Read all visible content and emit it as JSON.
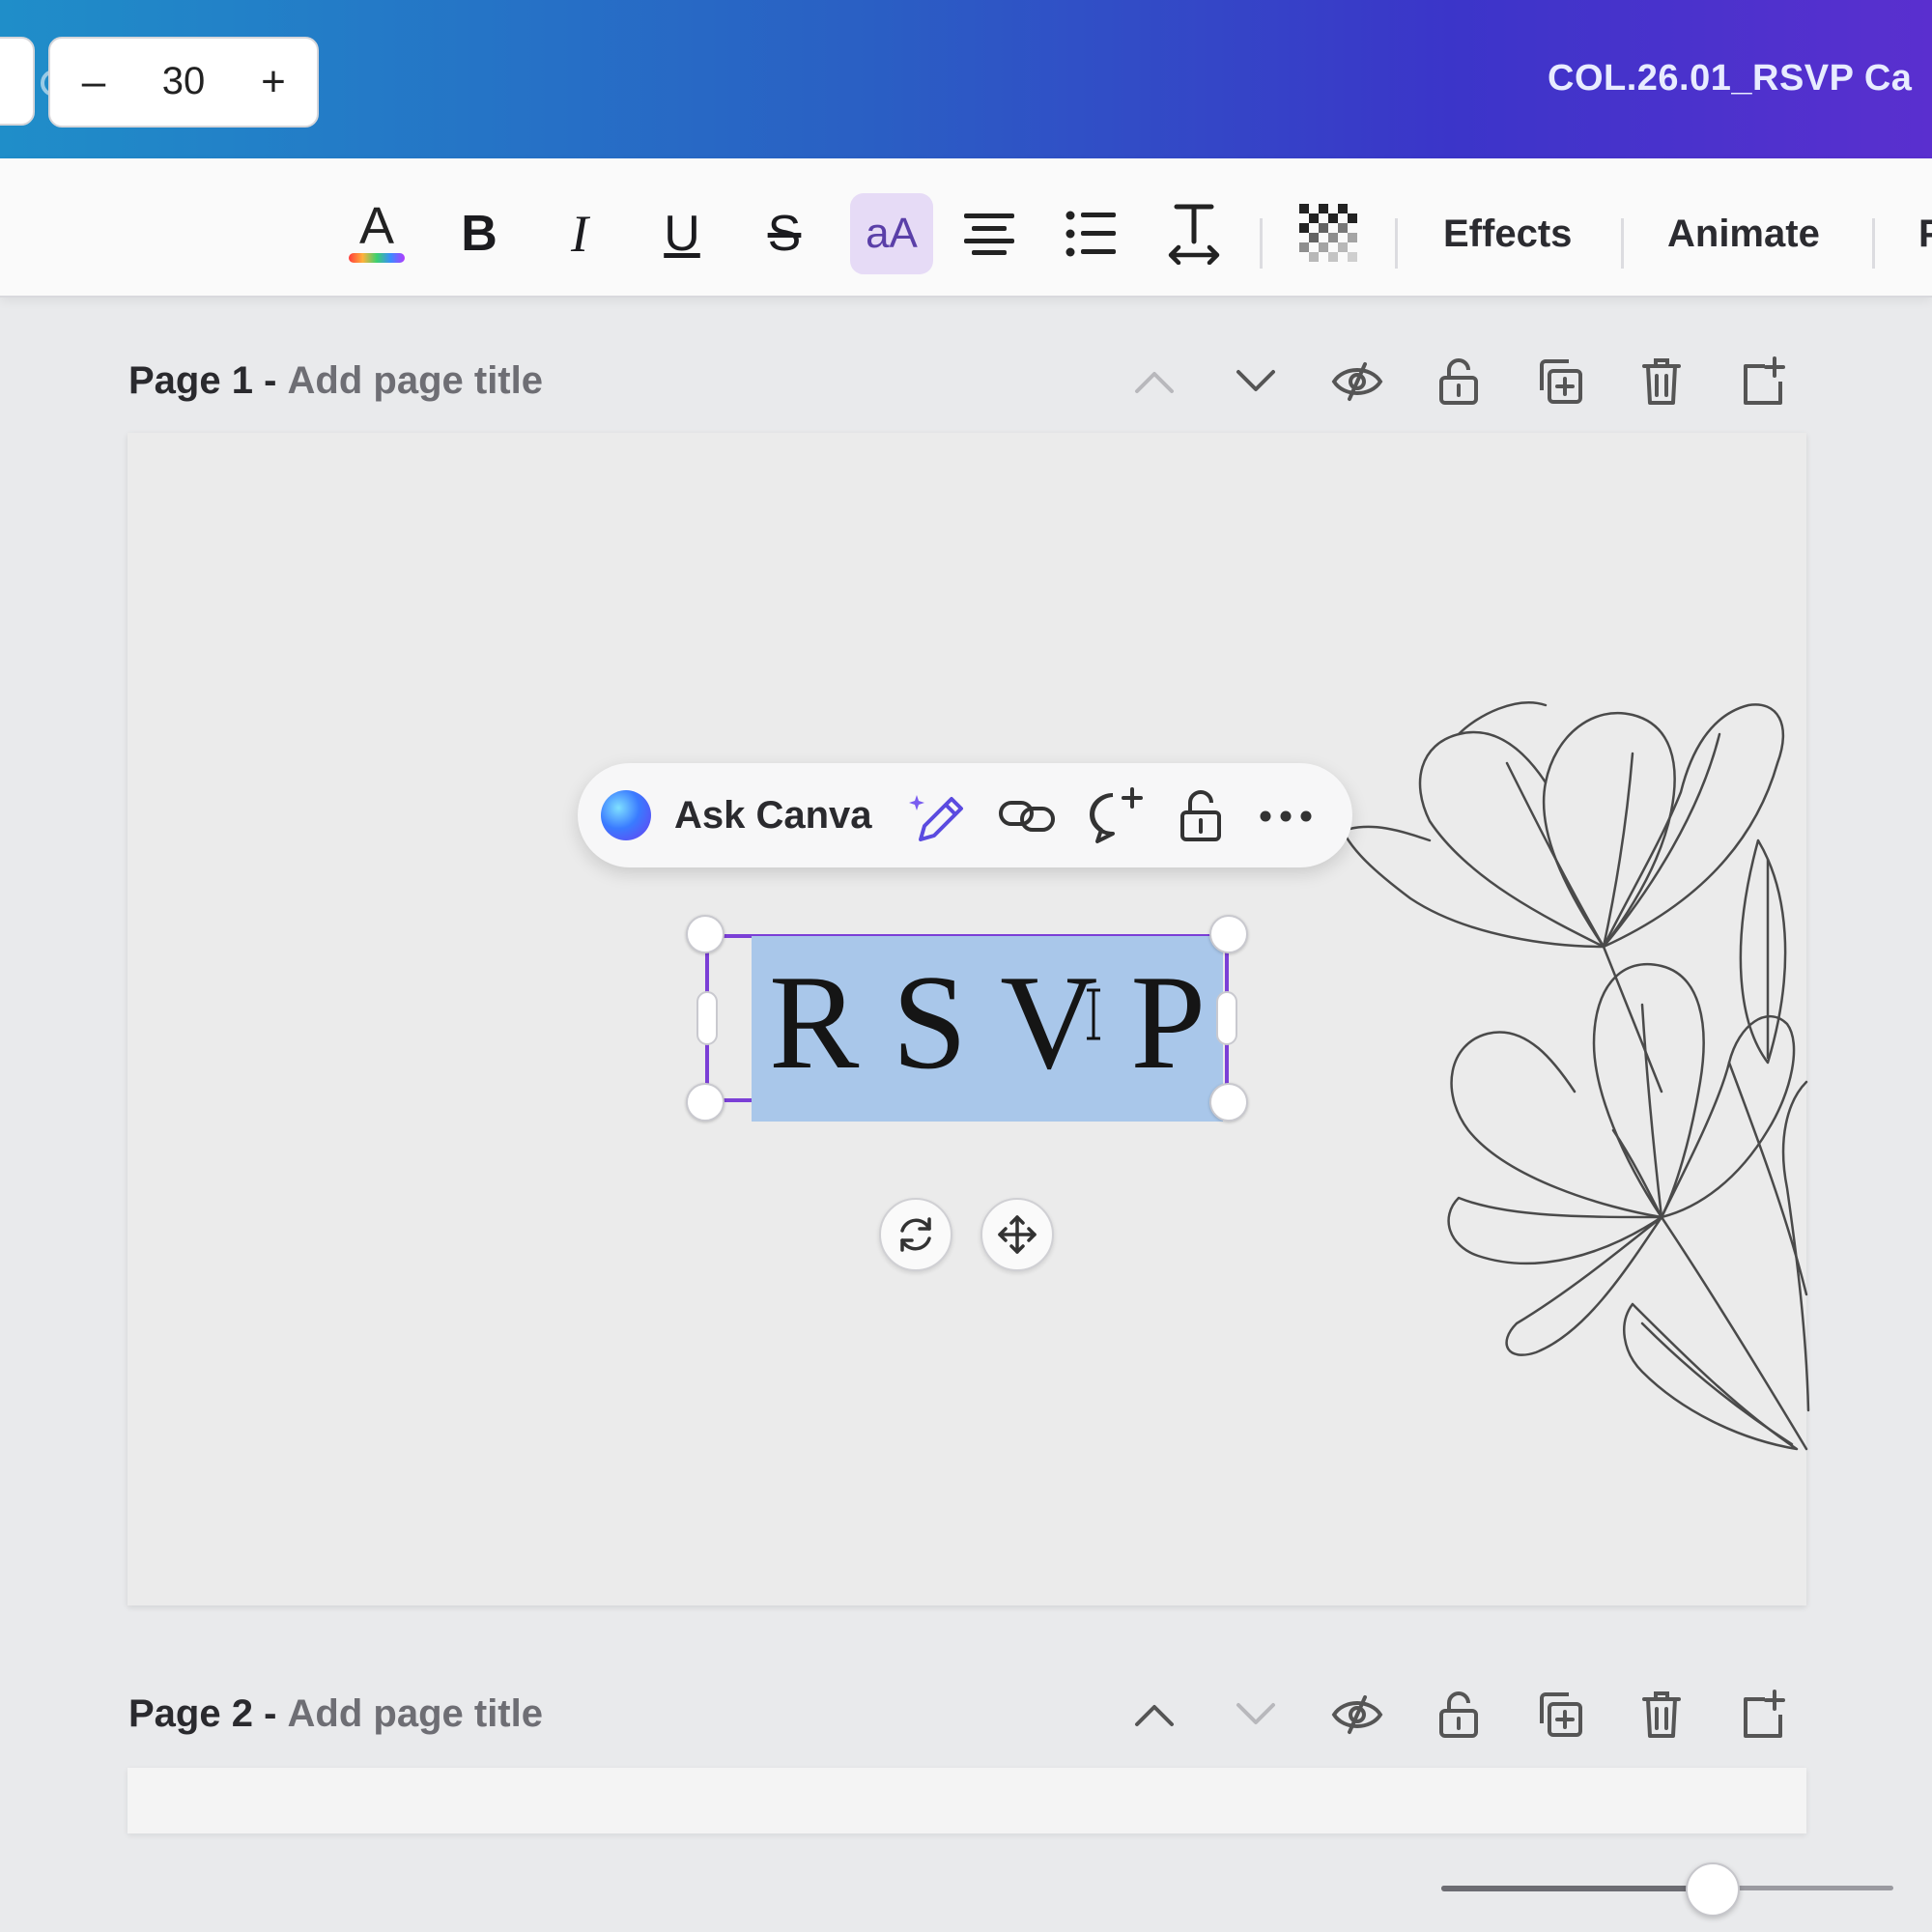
{
  "header": {
    "document_title": "COL.26.01_RSVP Ca"
  },
  "toolbar": {
    "font_size": "30",
    "minus_label": "–",
    "plus_label": "+",
    "bold_label": "B",
    "italic_label": "I",
    "underline_label": "U",
    "strike_label": "S",
    "case_label": "aA",
    "effects_label": "Effects",
    "animate_label": "Animate",
    "overflow_label": "P"
  },
  "pages": [
    {
      "number_label": "Page 1 -",
      "title_placeholder": "Add page title"
    },
    {
      "number_label": "Page 2 -",
      "title_placeholder": "Add page title"
    }
  ],
  "context_bar": {
    "ask_label": "Ask Canva"
  },
  "canvas": {
    "selected_text": "RSVP"
  },
  "colors": {
    "selection_border": "#7b3fd6",
    "text_highlight": "#a9c7ea",
    "case_active_bg": "#e6dbf6"
  },
  "zoom": {
    "level_fraction": 0.6
  }
}
